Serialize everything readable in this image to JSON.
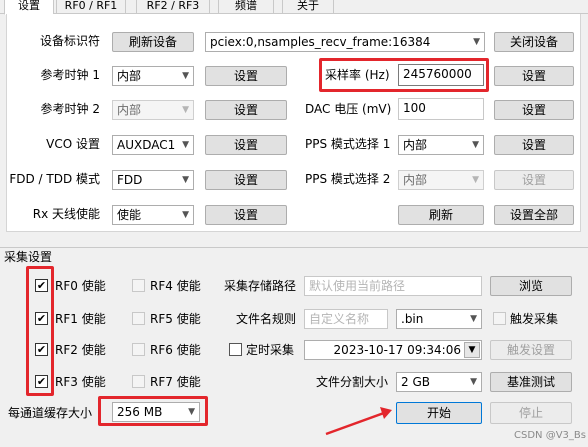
{
  "tabs": [
    "设置",
    "RF0 / RF1",
    "RF2 / RF3",
    "频谱",
    "关于"
  ],
  "settings": {
    "device_id_label": "设备标识符",
    "refresh_device_btn": "刷新设备",
    "device_value": "pciex:0,nsamples_recv_frame:16384",
    "close_device_btn": "关闭设备",
    "ref_clock1_label": "参考时钟 1",
    "ref_clock1_value": "内部",
    "ref_clock2_label": "参考时钟 2",
    "ref_clock2_value": "内部",
    "vco_label": "VCO 设置",
    "vco_value": "AUXDAC1",
    "fdd_label": "FDD / TDD 模式",
    "fdd_value": "FDD",
    "rx_ant_label": "Rx 天线使能",
    "rx_ant_value": "使能",
    "set_btn": "设置",
    "samplerate_label": "采样率 (Hz)",
    "samplerate_value": "245760000",
    "dac_label": "DAC 电压 (mV)",
    "dac_value": "100",
    "pps1_label": "PPS 模式选择 1",
    "pps1_value": "内部",
    "pps2_label": "PPS 模式选择 2",
    "pps2_value": "内部",
    "refresh_btn": "刷新",
    "set_all_btn": "设置全部"
  },
  "capture": {
    "section_title": "采集设置",
    "rf0": "RF0 使能",
    "rf1": "RF1 使能",
    "rf2": "RF2 使能",
    "rf3": "RF3 使能",
    "rf4": "RF4 使能",
    "rf5": "RF5 使能",
    "rf6": "RF6 使能",
    "rf7": "RF7 使能",
    "check_mark": "✔",
    "storage_path_label": "采集存储路径",
    "storage_path_placeholder": "默认使用当前路径",
    "browse_btn": "浏览",
    "filename_label": "文件名规则",
    "filename_placeholder": "自定义名称",
    "ext_value": ".bin",
    "trigger_capture_label": "触发采集",
    "timed_capture_label": "定时采集",
    "datetime_value": "2023-10-17 09:34:06",
    "trigger_settings_btn": "触发设置",
    "file_split_label": "文件分割大小",
    "file_split_value": "2 GB",
    "benchmark_btn": "基准测试",
    "buffer_label": "每通道缓存大小",
    "buffer_value": "256 MB",
    "start_btn": "开始",
    "stop_btn": "停止"
  },
  "watermark": "CSDN @V3_Bs",
  "colors": {
    "highlight": "#e3262c",
    "background": "#f0f0f0",
    "panel": "#ffffff"
  }
}
